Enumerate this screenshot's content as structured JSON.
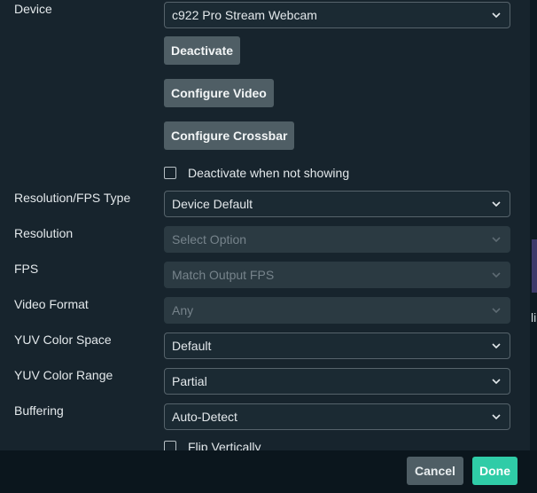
{
  "device": {
    "label": "Device",
    "select_value": "c922 Pro Stream Webcam",
    "deactivate_label": "Deactivate",
    "configure_video_label": "Configure Video",
    "configure_crossbar_label": "Configure Crossbar",
    "deactivate_when_not_showing_label": "Deactivate when not showing",
    "deactivate_when_not_showing_checked": false
  },
  "resolution_fps_type": {
    "label": "Resolution/FPS Type",
    "value": "Device Default"
  },
  "resolution": {
    "label": "Resolution",
    "placeholder": "Select Option",
    "disabled": true
  },
  "fps": {
    "label": "FPS",
    "value": "Match Output FPS",
    "disabled": true
  },
  "video_format": {
    "label": "Video Format",
    "value": "Any",
    "disabled": true
  },
  "yuv_color_space": {
    "label": "YUV Color Space",
    "value": "Default"
  },
  "yuv_color_range": {
    "label": "YUV Color Range",
    "value": "Partial"
  },
  "buffering": {
    "label": "Buffering",
    "value": "Auto-Detect"
  },
  "flip_vertically": {
    "label": "Flip Vertically",
    "checked": false
  },
  "footer": {
    "cancel_label": "Cancel",
    "done_label": "Done"
  },
  "edge": {
    "glyph": "li"
  },
  "colors": {
    "background": "#17242d",
    "footer_background": "#0b161d",
    "button_gray": "#4f5e65",
    "accent_done": "#2fcca7",
    "disabled_field": "#2b3a42"
  },
  "icons": {
    "dropdown": "chevron-down-icon",
    "checkbox": "checkbox-icon"
  }
}
